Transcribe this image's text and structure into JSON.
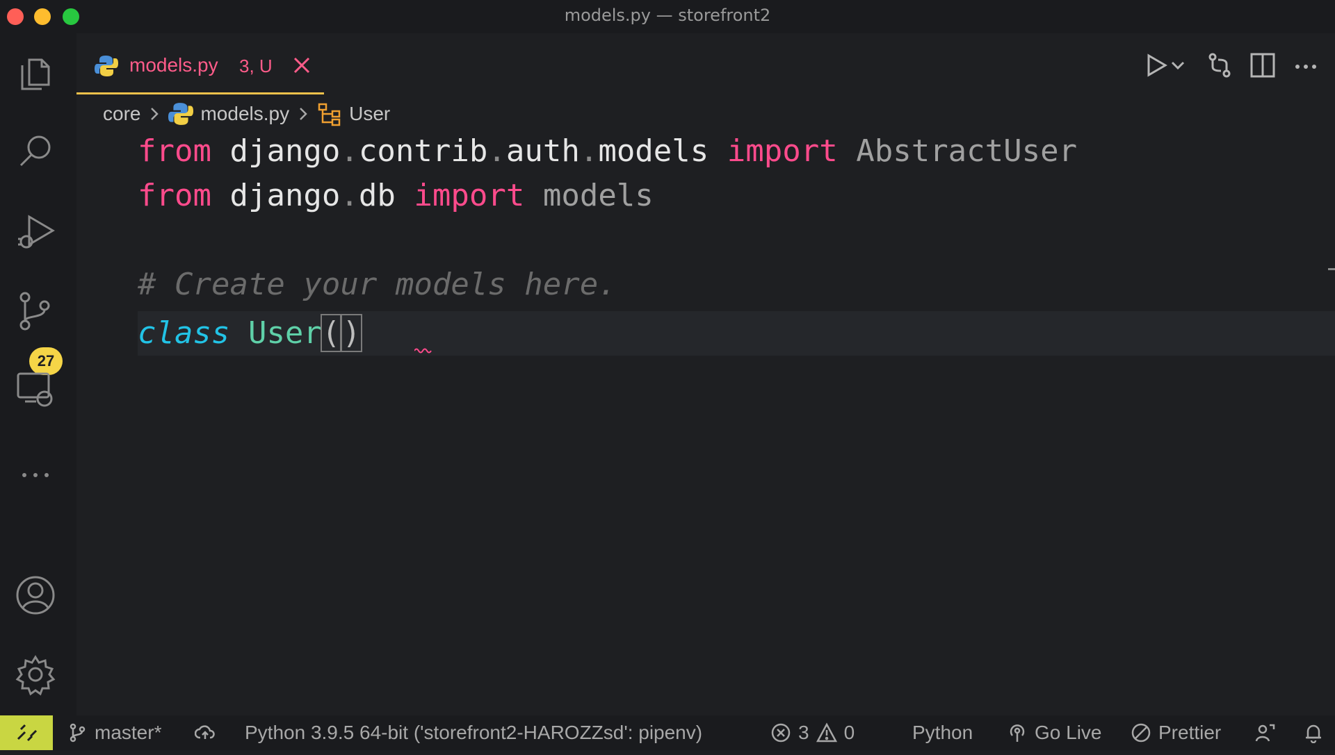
{
  "window": {
    "title": "models.py — storefront2"
  },
  "activity_bar": {
    "scm_badge": "27"
  },
  "tab": {
    "filename": "models.py",
    "status": "3, U"
  },
  "breadcrumb": {
    "folder": "core",
    "file": "models.py",
    "symbol": "User"
  },
  "code": {
    "line1": {
      "from": "from",
      "m1": "django",
      "d1": ".",
      "m2": "contrib",
      "d2": ".",
      "m3": "auth",
      "d3": ".",
      "m4": "models",
      "import": "import",
      "name": "AbstractUser"
    },
    "line2": {
      "from": "from",
      "m1": "django",
      "d1": ".",
      "m2": "db",
      "import": "import",
      "name": "models"
    },
    "line3": {
      "comment": "# Create your models here."
    },
    "line4": {
      "class": "class",
      "name": "User",
      "open": "(",
      "close": ")"
    }
  },
  "status_bar": {
    "branch": "master*",
    "interpreter": "Python 3.9.5 64-bit ('storefront2-HAROZZsd': pipenv)",
    "errors": "3",
    "warnings": "0",
    "language": "Python",
    "go_live": "Go Live",
    "prettier": "Prettier"
  },
  "colors": {
    "accent_tab_underline": "#f0c14b",
    "badge": "#f5d547",
    "remote": "#c9d642",
    "keyword": "#ff4b8c"
  }
}
